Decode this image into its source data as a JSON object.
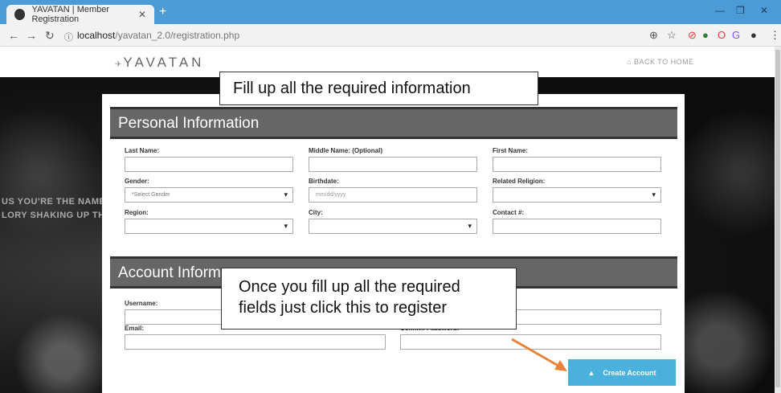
{
  "browser": {
    "tab_title": "YAVATAN | Member Registration",
    "url_host": "localhost",
    "url_path": "/yavatan_2.0/registration.php"
  },
  "site": {
    "logo": "YAVATAN",
    "back_link": "BACK TO HOME"
  },
  "background_text": [
    "US YOU'RE THE NAME WE",
    "LORY SHAKING UP THE EA"
  ],
  "personal": {
    "heading": "Personal Information",
    "last_name_label": "Last Name:",
    "middle_name_label": "Middle Name: (Optional)",
    "first_name_label": "First Name:",
    "gender_label": "Gender:",
    "gender_value": "*Select Gender",
    "birthdate_label": "Birthdate:",
    "birthdate_placeholder": "mm/dd/yyyy",
    "religion_label": "Related Religion:",
    "region_label": "Region:",
    "city_label": "City:",
    "contact_label": "Contact #:"
  },
  "account": {
    "heading": "Account Inform",
    "username_label": "Username:",
    "email_label": "Email:",
    "confirm_label": "Confirm Password:"
  },
  "create_button": "Create Account",
  "callouts": {
    "top": "Fill up all the required information",
    "bottom_line1": "Once you fill up all the required",
    "bottom_line2": "fields just click this to register"
  },
  "colors": {
    "accent": "#4ab0de",
    "section": "#666666",
    "arrow": "#e8823a",
    "tabbar": "#4a9bd6"
  }
}
